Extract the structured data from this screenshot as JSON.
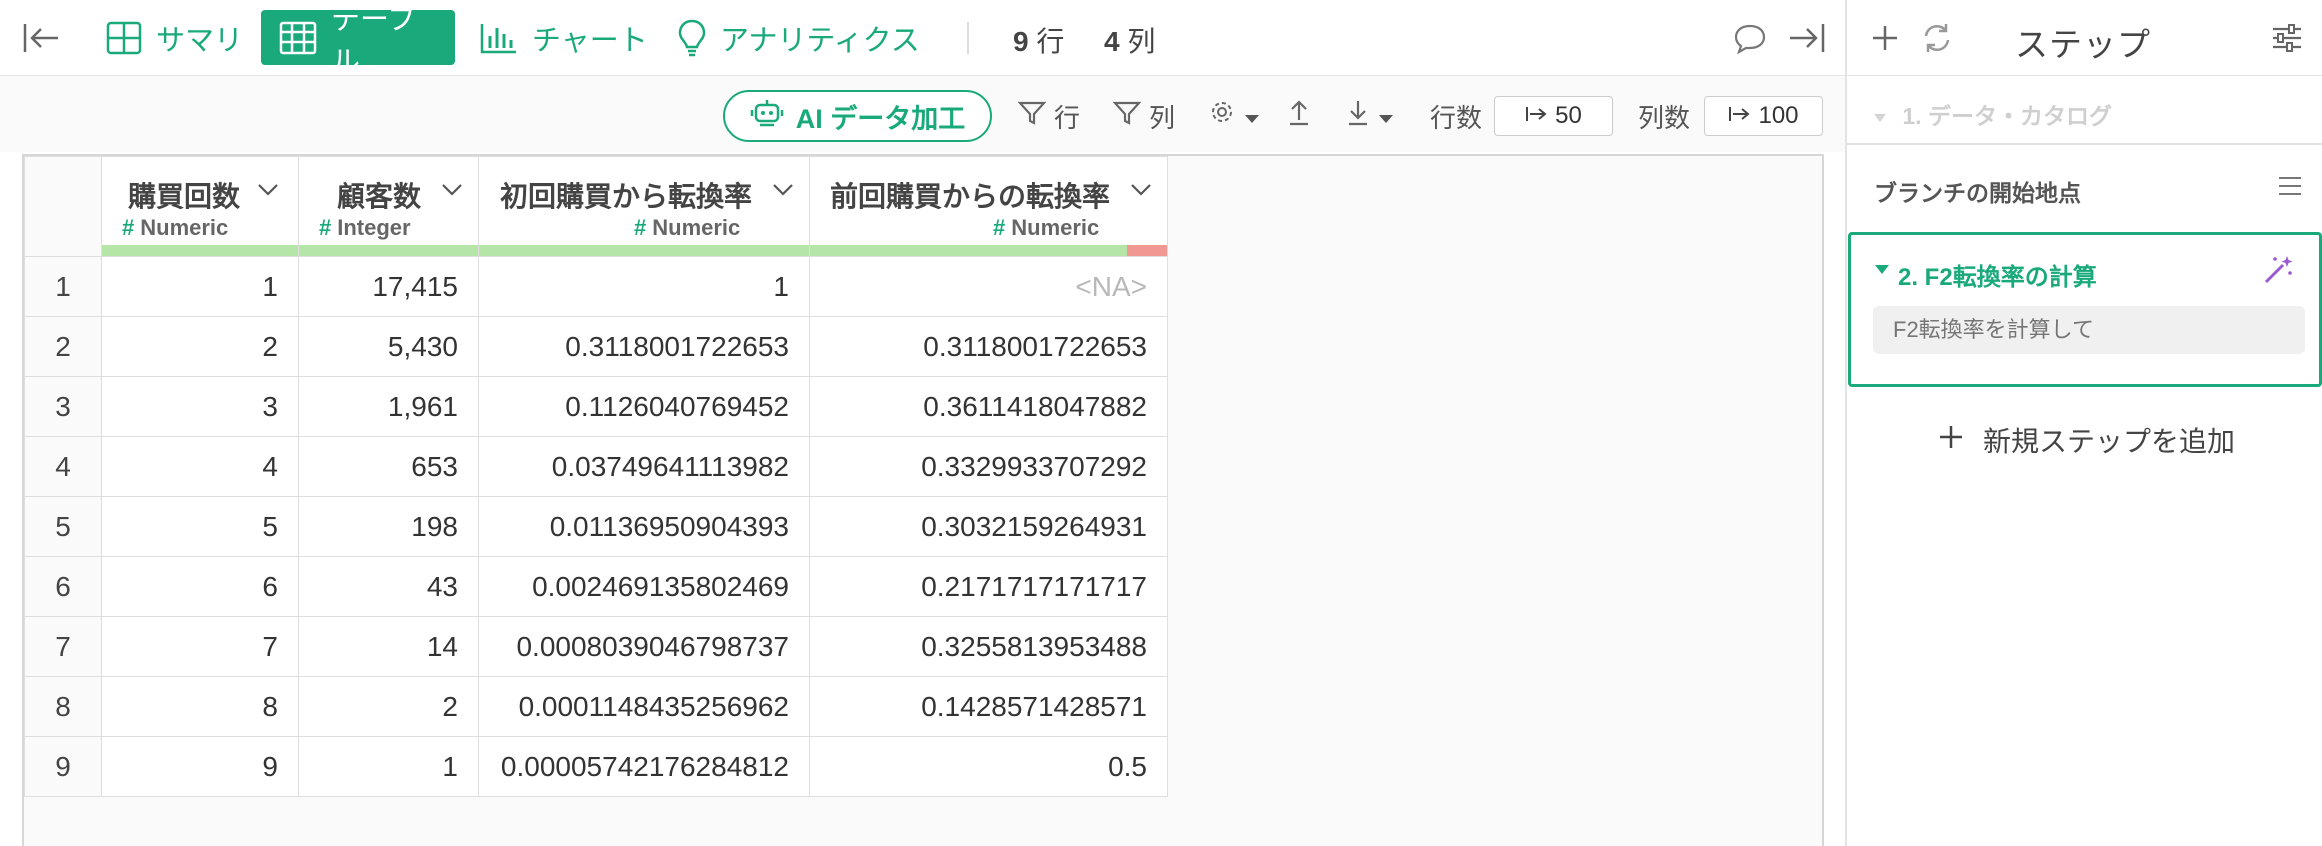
{
  "toolbar": {
    "tabs": [
      {
        "label": "サマリ",
        "icon": "summary-grid-icon"
      },
      {
        "label": "テーブル",
        "icon": "table-icon",
        "active": true
      },
      {
        "label": "チャート",
        "icon": "bar-chart-icon"
      },
      {
        "label": "アナリティクス",
        "icon": "lightbulb-icon"
      }
    ],
    "row_count": "9",
    "row_unit": "行",
    "col_count": "4",
    "col_unit": "列"
  },
  "toolbar2": {
    "ai_label": "AI データ加工",
    "filter_row": "行",
    "filter_col": "列",
    "rows_label": "行数",
    "rows_value": "50",
    "cols_label": "列数",
    "cols_value": "100"
  },
  "right_panel": {
    "title": "ステップ",
    "step1": "1. データ・カタログ",
    "branch_label": "ブランチの開始地点",
    "step2_title": "2. F2転換率の計算",
    "step2_placeholder": "F2転換率を計算して",
    "add_step": "新規ステップを追加"
  },
  "table": {
    "columns": [
      {
        "name": "購買回数",
        "type": "Numeric"
      },
      {
        "name": "顧客数",
        "type": "Integer"
      },
      {
        "name": "初回購買から転換率",
        "type": "Numeric"
      },
      {
        "name": "前回購買からの転換率",
        "type": "Numeric"
      }
    ],
    "rows": [
      [
        "1",
        "1",
        "17,415",
        "1",
        "<NA>"
      ],
      [
        "2",
        "2",
        "5,430",
        "0.3118001722653",
        "0.3118001722653"
      ],
      [
        "3",
        "3",
        "1,961",
        "0.1126040769452",
        "0.3611418047882"
      ],
      [
        "4",
        "4",
        "653",
        "0.03749641113982",
        "0.3329933707292"
      ],
      [
        "5",
        "5",
        "198",
        "0.01136950904393",
        "0.3032159264931"
      ],
      [
        "6",
        "6",
        "43",
        "0.002469135802469",
        "0.2171717171717"
      ],
      [
        "7",
        "7",
        "14",
        "0.0008039046798737",
        "0.3255813953488"
      ],
      [
        "8",
        "8",
        "2",
        "0.0001148435256962",
        "0.1428571428571"
      ],
      [
        "9",
        "9",
        "1",
        "0.00005742176284812",
        "0.5"
      ]
    ],
    "missing_fraction_col4": 0.111
  },
  "colors": {
    "accent": "#1aa97a",
    "quality_ok": "#b5e6a8",
    "quality_missing": "#f09891",
    "wand": "#9b59d0"
  }
}
